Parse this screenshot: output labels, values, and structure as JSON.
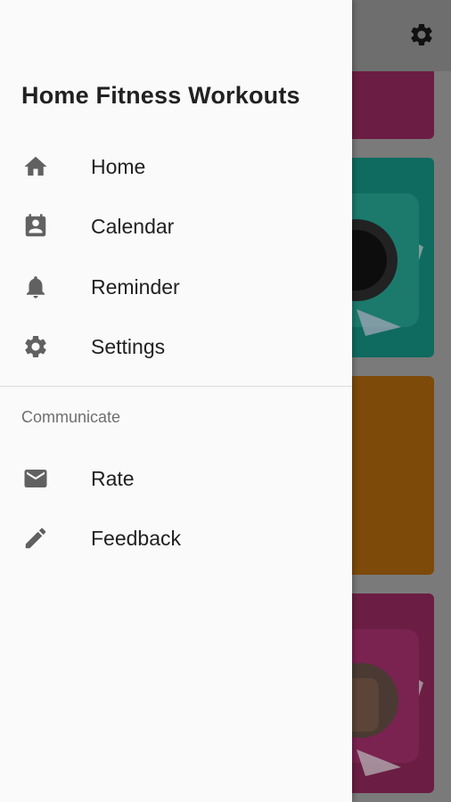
{
  "drawer": {
    "title": "Home Fitness Workouts",
    "items": [
      {
        "label": "Home",
        "icon": "home-icon"
      },
      {
        "label": "Calendar",
        "icon": "calendar-contact-icon"
      },
      {
        "label": "Reminder",
        "icon": "bell-icon"
      },
      {
        "label": "Settings",
        "icon": "gear-icon"
      }
    ],
    "section_header": "Communicate",
    "communicate_items": [
      {
        "label": "Rate",
        "icon": "email-icon"
      },
      {
        "label": "Feedback",
        "icon": "pencil-icon"
      }
    ]
  },
  "background": {
    "toolbar_icon": "gear-icon",
    "card_colors": [
      "#6b1d43",
      "#0f6b5f",
      "#7d4a0a",
      "#6b1d43"
    ],
    "scrim_color": "#000000"
  }
}
